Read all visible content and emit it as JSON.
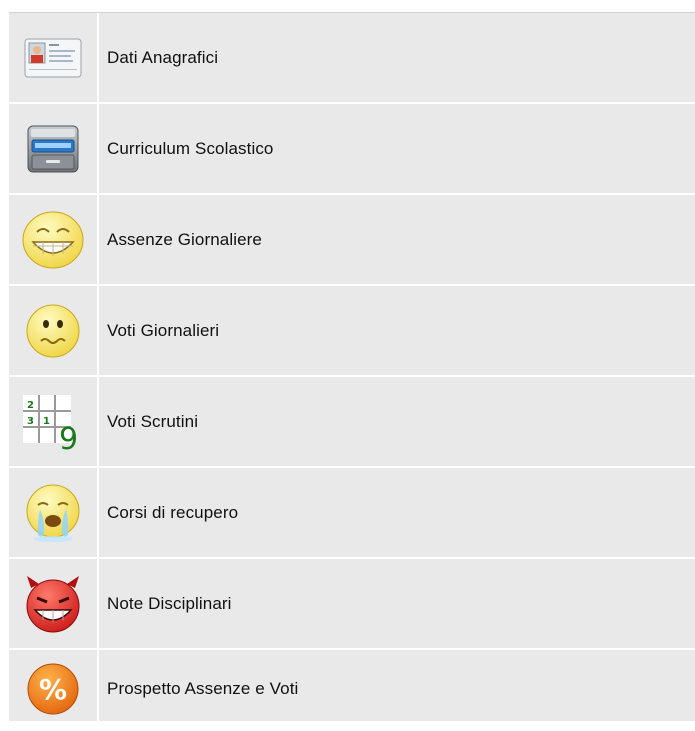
{
  "menu": {
    "items": [
      {
        "label": "Dati Anagrafici",
        "icon": "id-card-icon"
      },
      {
        "label": "Curriculum Scolastico",
        "icon": "file-cabinet-icon"
      },
      {
        "label": "Assenze Giornaliere",
        "icon": "grin-smiley-icon"
      },
      {
        "label": "Voti Giornalieri",
        "icon": "worried-smiley-icon"
      },
      {
        "label": "Voti Scrutini",
        "icon": "sudoku-grid-icon"
      },
      {
        "label": "Corsi di recupero",
        "icon": "crying-smiley-icon"
      },
      {
        "label": "Note Disciplinari",
        "icon": "devil-smiley-icon"
      },
      {
        "label": "Prospetto Assenze e Voti",
        "icon": "percent-icon"
      }
    ]
  },
  "colors": {
    "background": "#e9e9e9",
    "separator": "#ffffff",
    "text": "#111111",
    "smiley_yellow": "#f7e04a",
    "devil_red": "#e02020",
    "percent_orange": "#f07a10",
    "grid_number_green": "#1a7a1a"
  }
}
